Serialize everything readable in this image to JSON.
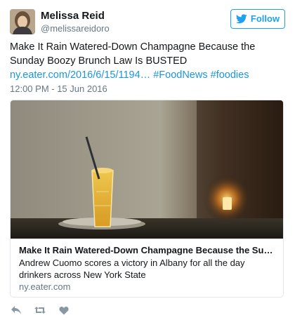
{
  "user": {
    "name": "Melissa Reid",
    "handle": "@melissareidoro"
  },
  "follow_button": {
    "label": "Follow",
    "icon": "twitter-bird-icon"
  },
  "tweet": {
    "text_part1": "Make It Rain Watered-Down Champagne Because the Sunday Boozy Brunch Law Is BUSTED",
    "link": "ny.eater.com/2016/6/15/1194…",
    "hashtag1": "#FoodNews",
    "hashtag2": "#foodies",
    "timestamp": "12:00 PM - 15 Jun 2016"
  },
  "card": {
    "title": "Make It Rain Watered-Down Champagne Because the Sunday ...",
    "description": "Andrew Cuomo scores a victory in Albany for all the day drinkers across New York State",
    "domain": "ny.eater.com"
  },
  "actions": [
    "reply-icon",
    "retweet-icon",
    "like-icon"
  ],
  "colors": {
    "link": "#1b95e0",
    "follow": "#1da1f2",
    "muted": "#657786",
    "text": "#14171a",
    "border": "#e1e8ed"
  }
}
